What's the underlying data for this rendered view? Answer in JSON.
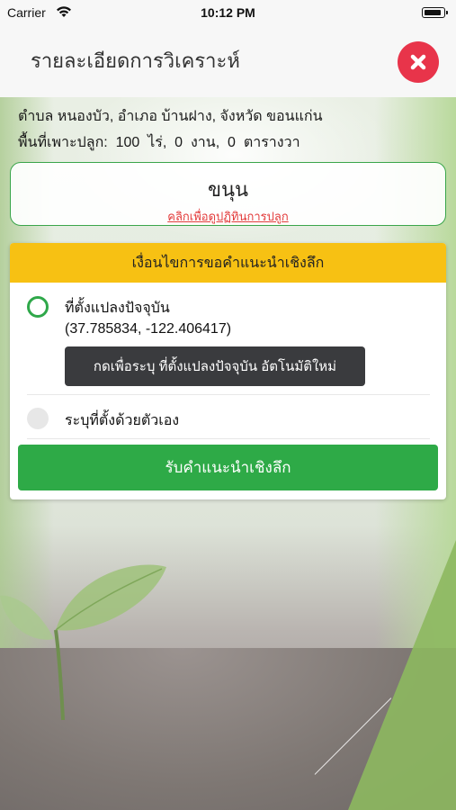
{
  "status_bar": {
    "carrier": "Carrier",
    "time": "10:12 PM",
    "wifi_icon": "wifi-icon",
    "battery_icon": "battery-icon"
  },
  "header": {
    "title": "รายละเอียดการวิเคราะห์",
    "close_icon": "close-icon",
    "close_color": "#e8344a"
  },
  "info": {
    "location": "ตำบล หนองบัว, อำเภอ บ้านฝาง, จังหวัด ขอนแก่น",
    "area": "พื้นที่เพาะปลูก:  100  ไร่,  0  งาน,  0  ตารางวา"
  },
  "crop": {
    "name": "ขนุน",
    "calendar_link": "คลิกเพื่อดูปฏิทินการปลูก",
    "border_color": "#3aa54a"
  },
  "advice_panel": {
    "header": "เงื่อนไขการขอคำแนะนำเชิงลึก",
    "header_color": "#f7c113",
    "option_current_label": "ที่ตั้งแปลงปัจจุบัน",
    "option_current_selected": true,
    "coordinates": "(37.785834, -122.406417)",
    "relocate_button": "กดเพื่อระบุ ที่ตั้งแปลงปัจจุบัน อัตโนมัติใหม่",
    "option_manual_label": "ระบุที่ตั้งด้วยตัวเอง",
    "option_manual_selected": false,
    "submit_button": "รับคำแนะนำเชิงลึก",
    "accent_color": "#2eaa47"
  }
}
